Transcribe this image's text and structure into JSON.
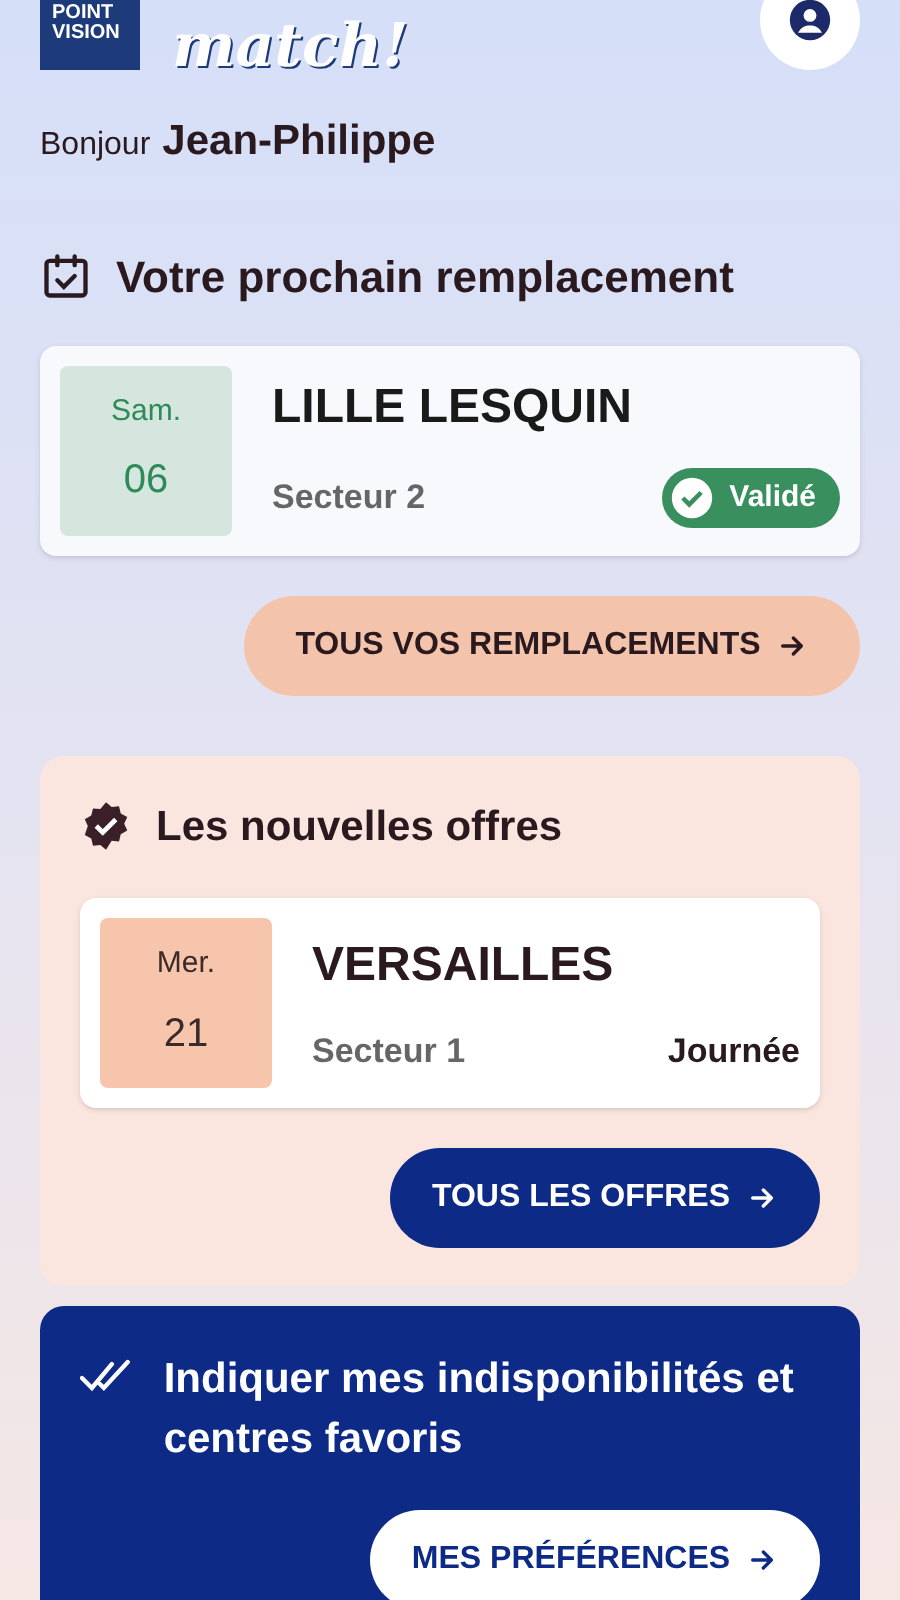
{
  "header": {
    "logo_lines": [
      "POINT",
      "VISION"
    ],
    "logo_script": "match!"
  },
  "greeting": {
    "salutation": "Bonjour",
    "name": "Jean-Philippe"
  },
  "next_replacement": {
    "title": "Votre prochain remplacement",
    "day": "Sam.",
    "date": "06",
    "center": "LILLE LESQUIN",
    "sector": "Secteur 2",
    "status": {
      "kind": "validated",
      "label": "Validé"
    }
  },
  "all_replacements_button": "TOUS VOS REMPLACEMENTS",
  "offers": {
    "title": "Les nouvelles offres",
    "items": [
      {
        "day": "Mer.",
        "date": "21",
        "center": "VERSAILLES",
        "sector": "Secteur 1",
        "period": "Journée"
      }
    ],
    "button": "TOUS LES OFFRES"
  },
  "preferences": {
    "title": "Indiquer mes indisponibilités et centres favoris",
    "button": "MES PRÉFÉRENCES"
  }
}
